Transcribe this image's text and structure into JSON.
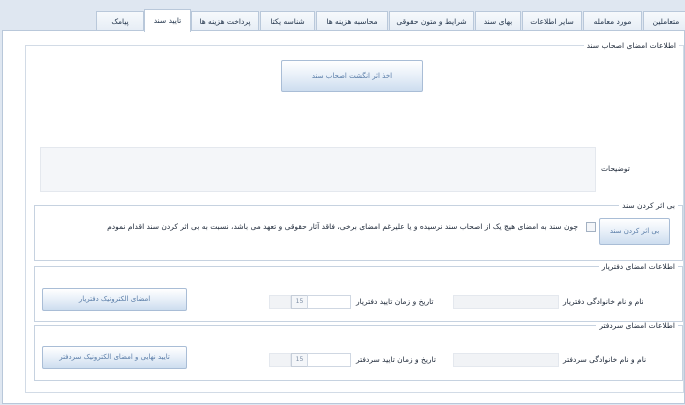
{
  "tabs": [
    {
      "label": "متعاملین",
      "active": false
    },
    {
      "label": "مورد معامله",
      "active": false
    },
    {
      "label": "سایر اطلاعات",
      "active": false
    },
    {
      "label": "بهای سند",
      "active": false
    },
    {
      "label": "شرایط و متون حقوقی",
      "active": false
    },
    {
      "label": "محاسبه هزینه ها",
      "active": false
    },
    {
      "label": "شناسه یکتا",
      "active": false
    },
    {
      "label": "پرداخت هزینه ها",
      "active": false
    },
    {
      "label": "تایید سند",
      "active": true
    },
    {
      "label": "پیامک",
      "active": false
    }
  ],
  "signatures": {
    "legend": "اطلاعات امضای اصحاب سند",
    "fingerprint_button": "اخذ اثر انگشت اصحاب سند",
    "description_label": "توضیحات",
    "description_value": ""
  },
  "void": {
    "legend": "بی اثر کردن سند",
    "button": "بی اثر کردن سند",
    "checkbox_label": "چون سند به امضای هیچ یک از اصحاب سند نرسیده و یا علیرغم امضای برخی، فاقد آثار حقوقی و تعهد می باشد، نسبت به بی اثر کردن سند اقدام نمودم",
    "checked": false
  },
  "registrar": {
    "legend": "اطلاعات امضای دفتریار",
    "name_label": "نام و نام خانوادگی دفتریار",
    "name_value": "",
    "date_label": "تاریخ و زمان تایید دفتریار",
    "date_value": "",
    "button": "امضای الکترونیک دفتریار"
  },
  "notary": {
    "legend": "اطلاعات امضای سردفتر",
    "name_label": "نام و نام خانوادگی سردفتر",
    "name_value": "",
    "date_label": "تاریخ و زمان تایید سردفتر",
    "date_value": "",
    "button": "تایید نهایی و امضای الکترونیک سردفتر"
  },
  "calendar_icon_text": "15",
  "colors": {
    "background": "#dfe7f1",
    "panel": "#ffffff",
    "button_text": "#5a7da8",
    "border": "#b9c8da"
  }
}
